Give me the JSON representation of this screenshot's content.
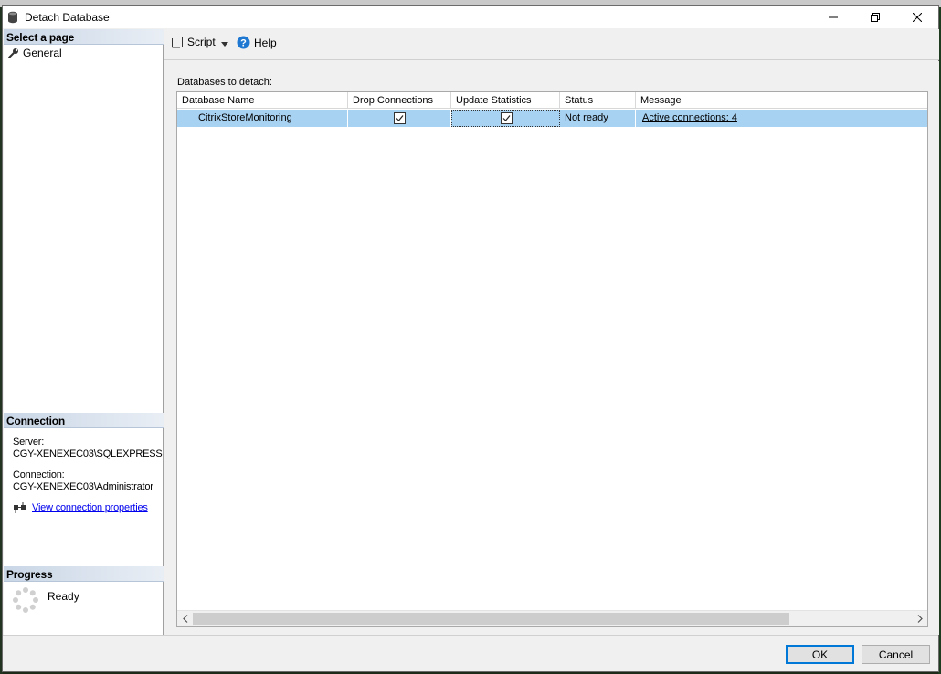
{
  "window": {
    "title": "Detach Database",
    "controls": [
      "minimize",
      "restore",
      "close"
    ]
  },
  "left_pane": {
    "select_page": {
      "header": "Select a page",
      "items": [
        {
          "label": "General",
          "icon": "wrench-icon"
        }
      ]
    },
    "connection": {
      "header": "Connection",
      "server_label": "Server:",
      "server_value": "CGY-XENEXEC03\\SQLEXPRESS",
      "connection_label": "Connection:",
      "connection_value": "CGY-XENEXEC03\\Administrator",
      "view_link": "View connection properties"
    },
    "progress": {
      "header": "Progress",
      "status": "Ready"
    }
  },
  "toolbar": {
    "script_label": "Script",
    "help_label": "Help"
  },
  "main": {
    "grid_label": "Databases to detach:",
    "columns": [
      "Database Name",
      "Drop Connections",
      "Update Statistics",
      "Status",
      "Message"
    ],
    "rows": [
      {
        "database_name": "CitrixStoreMonitoring",
        "drop_connections": true,
        "update_statistics": true,
        "status": "Not ready",
        "message": "Active connections: 4"
      }
    ]
  },
  "buttons": {
    "ok": "OK",
    "cancel": "Cancel"
  },
  "colors": {
    "selected_row": "#a8d2f2",
    "section_header": "#c9d6e6",
    "link": "#0000ee",
    "help_icon": "#1e78d2"
  }
}
